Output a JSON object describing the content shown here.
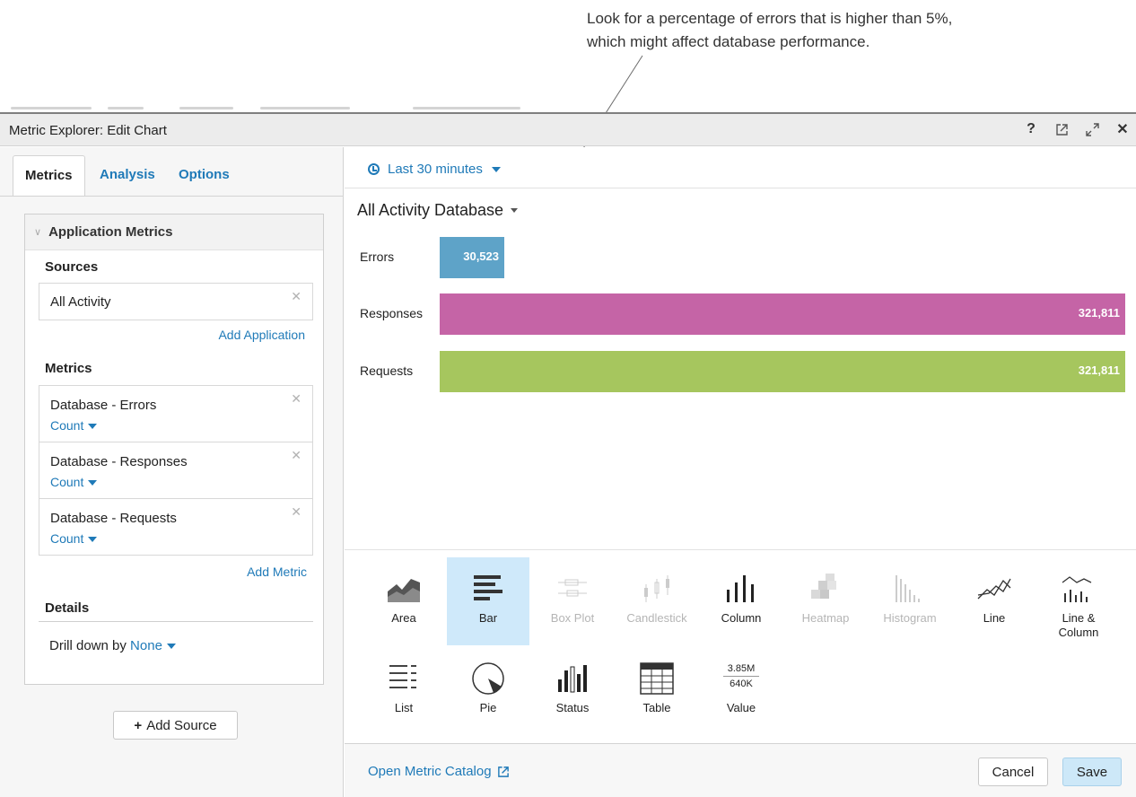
{
  "annotation": {
    "line1": "Look for a percentage of errors that is higher than 5%,",
    "line2": "which might affect database performance."
  },
  "window": {
    "title": "Metric Explorer: Edit Chart",
    "icons": [
      "help-icon",
      "external-link-icon",
      "expand-icon",
      "close-icon"
    ]
  },
  "tabs": [
    {
      "label": "Metrics",
      "active": true
    },
    {
      "label": "Analysis",
      "active": false
    },
    {
      "label": "Options",
      "active": false
    }
  ],
  "panel": {
    "header": "Application Metrics",
    "sources_label": "Sources",
    "source_value": "All Activity",
    "add_application": "Add Application",
    "metrics_label": "Metrics",
    "metrics": [
      {
        "name": "Database - Errors",
        "agg": "Count"
      },
      {
        "name": "Database - Responses",
        "agg": "Count"
      },
      {
        "name": "Database - Requests",
        "agg": "Count"
      }
    ],
    "add_metric": "Add Metric",
    "details_label": "Details",
    "drill_label": "Drill down by",
    "drill_value": "None"
  },
  "add_source": "Add Source",
  "time_range": "Last 30 minutes",
  "chart_title": "All Activity Database",
  "chart_data": {
    "type": "bar",
    "orientation": "horizontal",
    "categories": [
      "Errors",
      "Responses",
      "Requests"
    ],
    "values": [
      30523,
      321811,
      321811
    ],
    "value_labels": [
      "30,523",
      "321,811",
      "321,811"
    ],
    "colors": [
      "#5ea3c8",
      "#c564a6",
      "#a6c65e"
    ],
    "xlim": [
      0,
      321811
    ]
  },
  "chart_types": [
    {
      "label": "Area",
      "icon": "area-chart-icon"
    },
    {
      "label": "Bar",
      "icon": "bar-chart-icon",
      "selected": true
    },
    {
      "label": "Box Plot",
      "icon": "box-plot-icon",
      "disabled": true
    },
    {
      "label": "Candlestick",
      "icon": "candlestick-icon",
      "disabled": true
    },
    {
      "label": "Column",
      "icon": "column-chart-icon"
    },
    {
      "label": "Heatmap",
      "icon": "heatmap-icon",
      "disabled": true
    },
    {
      "label": "Histogram",
      "icon": "histogram-icon",
      "disabled": true
    },
    {
      "label": "Line",
      "icon": "line-chart-icon"
    },
    {
      "label": "Line &",
      "label2": "Column",
      "icon": "line-column-icon"
    },
    {
      "label": "List",
      "icon": "list-icon"
    },
    {
      "label": "Pie",
      "icon": "pie-chart-icon"
    },
    {
      "label": "Status",
      "icon": "status-icon"
    },
    {
      "label": "Table",
      "icon": "table-icon"
    },
    {
      "label": "Value",
      "icon": "value-icon",
      "sample_top": "3.85M",
      "sample_bottom": "640K"
    }
  ],
  "footer": {
    "catalog_link": "Open Metric Catalog",
    "cancel": "Cancel",
    "save": "Save"
  }
}
